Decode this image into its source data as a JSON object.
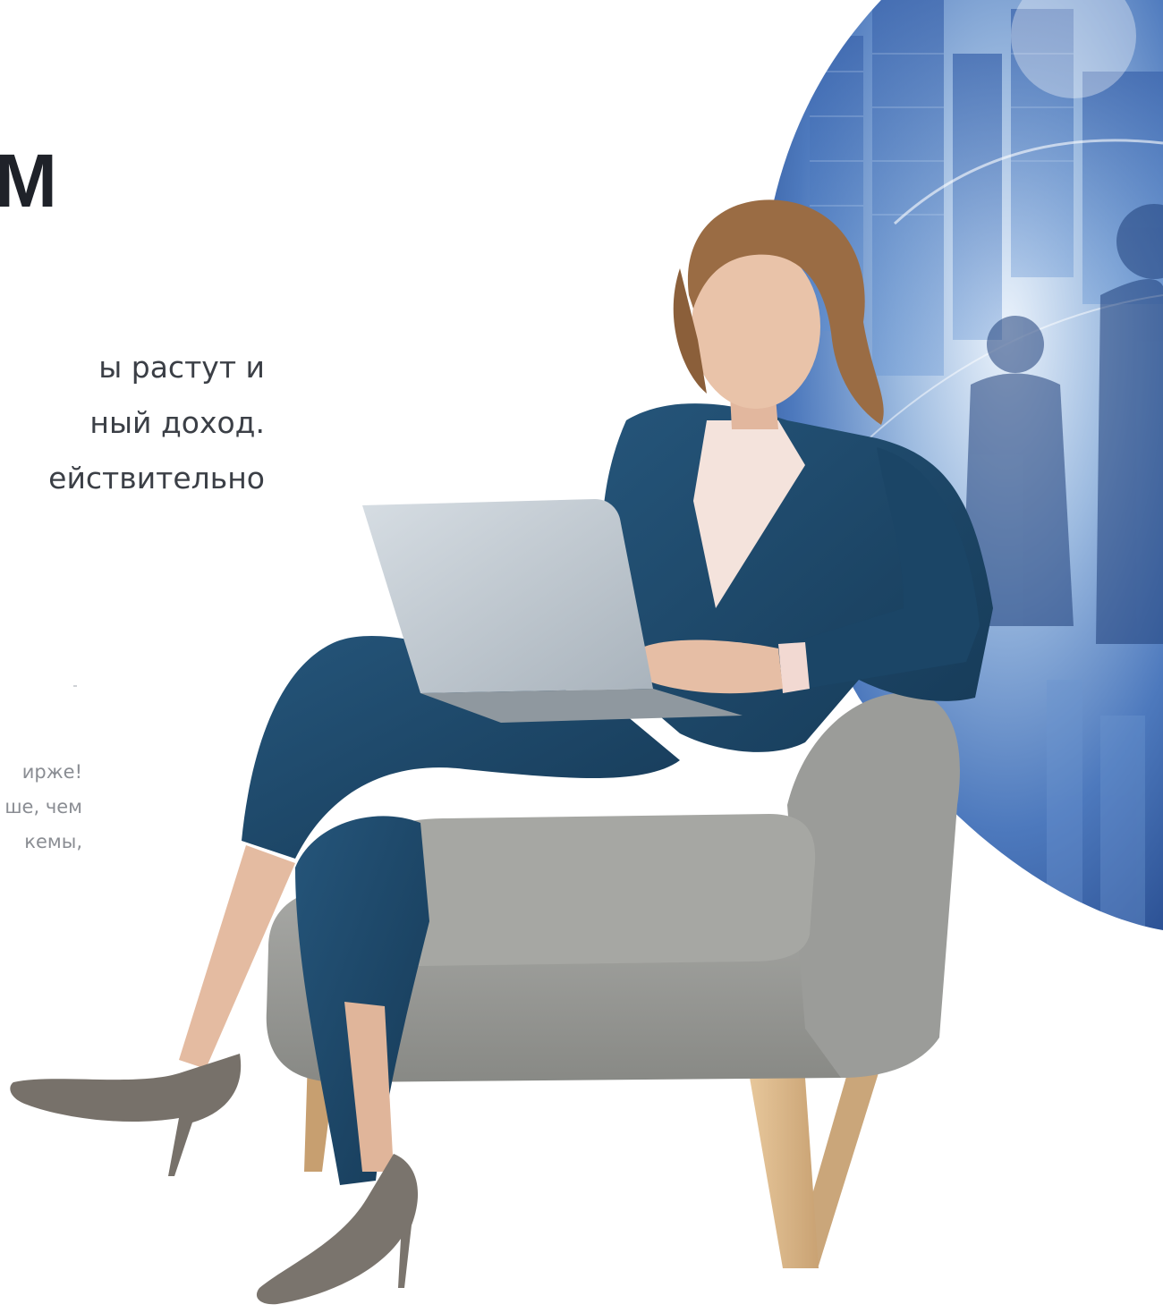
{
  "hero": {
    "headline": "М",
    "lead_lines": [
      "ы растут и",
      "ный доход.",
      "ействительно"
    ],
    "note_lines": [
      "ирже!",
      "ше, чем",
      "кемы,"
    ]
  },
  "illustration": {
    "subject": "businesswoman-in-armchair-with-laptop",
    "background": "city-skyline-globe"
  },
  "colors": {
    "headline": "#1f2229",
    "lead": "#3b3f46",
    "note": "#8a8d93",
    "suit": "#1c4566",
    "globe_blue": "#2d5fa8",
    "chair": "#9d9e9b"
  }
}
